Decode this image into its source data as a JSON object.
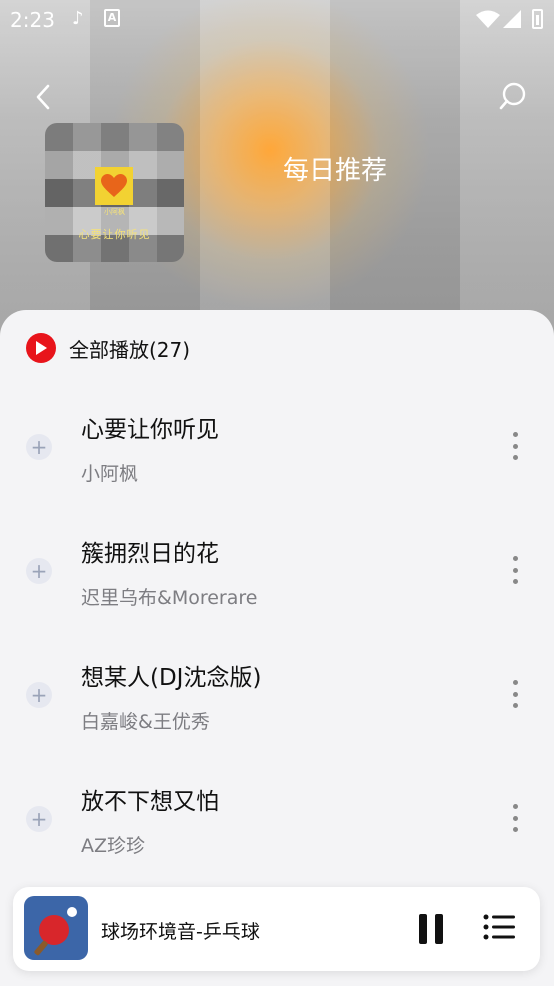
{
  "status": {
    "time": "2:23",
    "note_icon": "music-note-icon",
    "a_icon": "a-notification-icon"
  },
  "header": {
    "title": "每日推荐",
    "back_icon": "chevron-left-icon",
    "search_icon": "search-icon"
  },
  "cover": {
    "artist": "小阿枫",
    "title": "心要让你听见"
  },
  "play_all": {
    "label": "全部播放(27)",
    "accent": "#e8141b"
  },
  "songs": [
    {
      "title": "心要让你听见",
      "artist": "小阿枫"
    },
    {
      "title": "簇拥烈日的花",
      "artist": "迟里乌布&Morerare"
    },
    {
      "title": "想某人(DJ沈念版)",
      "artist": "白嘉峻&王优秀"
    },
    {
      "title": "放不下想又怕",
      "artist": "AZ珍珍"
    }
  ],
  "now_playing": {
    "title": "球场环境音-乒乓球"
  }
}
